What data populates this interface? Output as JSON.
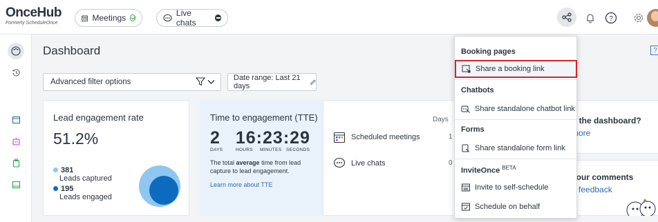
{
  "brand": {
    "logo": "OnceHub",
    "tagline": "Formerly ScheduleOnce"
  },
  "topbar": {
    "meetings_label": "Meetings",
    "live_chats_label": "Live chats"
  },
  "page": {
    "title": "Dashboard",
    "help_glyph": "?"
  },
  "filters": {
    "advanced_label": "Advanced filter options",
    "date_range_label": "Date range: Last 21 days"
  },
  "lead_card": {
    "title": "Lead engagement rate",
    "rate": "51.2%",
    "captured_count": "381",
    "captured_label": "Leads captured",
    "engaged_count": "195",
    "engaged_label": "Leads engaged"
  },
  "tte_card": {
    "title": "Time to engagement (TTE)",
    "days": "2",
    "hours": "16",
    "minutes": "23",
    "seconds": "29",
    "unit_days": "DAYS",
    "unit_hours": "HOURS",
    "unit_minutes": "MINUTES",
    "unit_seconds": "SECONDS",
    "desc_pre": "The total ",
    "desc_bold": "average",
    "desc_post": " time from lead capture to lead engagement.",
    "link": "Learn more about TTE"
  },
  "table_card": {
    "days_header": "Days",
    "rows": [
      {
        "label": "Scheduled meetings",
        "value": "1"
      },
      {
        "label": "Live chats",
        "value": "0"
      }
    ]
  },
  "right_cards": {
    "card1_line1": "o the dashboard?",
    "card1_link": "more",
    "card2_line1": "your comments",
    "card2_link": "e feedback"
  },
  "menu": {
    "sections": {
      "booking": "Booking pages",
      "chatbots": "Chatbots",
      "forms": "Forms",
      "inviteonce": "InviteOnce",
      "inviteonce_badge": "BETA"
    },
    "items": {
      "share_booking": "Share a booking link",
      "share_chatbot": "Share standalone chatbot link",
      "share_form": "Share standalone form link",
      "invite_self": "Invite to self-schedule",
      "schedule_behalf": "Schedule on behalf"
    }
  },
  "colors": {
    "accent_blue": "#2b6cb0",
    "chart_light": "#8ec7f0",
    "chart_dark": "#0d6bbf",
    "highlight_red": "#d6232a",
    "status_green": "#2ba84a"
  }
}
